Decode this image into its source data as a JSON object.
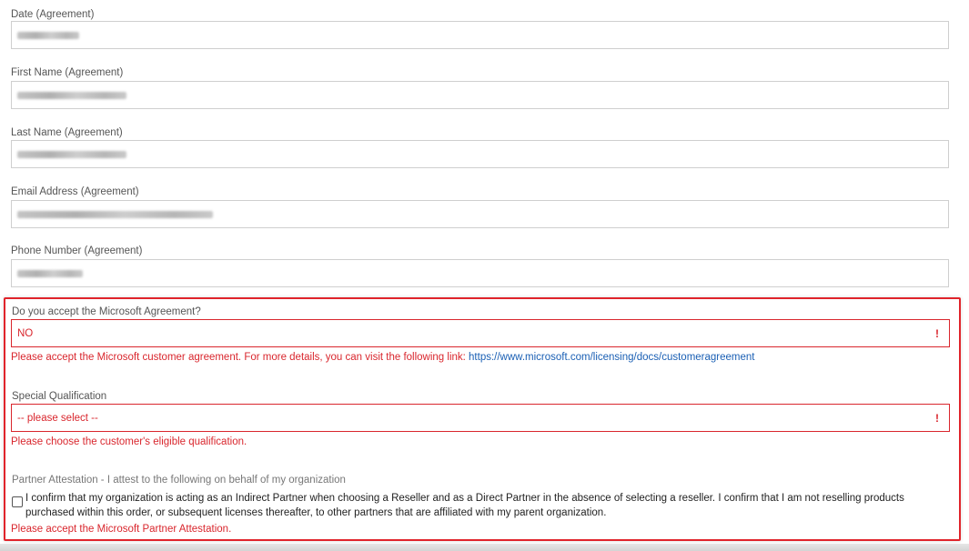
{
  "fields": [
    {
      "label": "Date (Agreement)"
    },
    {
      "label": "First Name (Agreement)"
    },
    {
      "label": "Last Name (Agreement)"
    },
    {
      "label": "Email Address (Agreement)"
    },
    {
      "label": "Phone Number (Agreement)"
    }
  ],
  "agreement": {
    "label": "Do you accept the Microsoft Agreement?",
    "value": "NO",
    "error_text": "Please accept the Microsoft customer agreement. For more details, you can visit the following link: ",
    "error_link": "https://www.microsoft.com/licensing/docs/customeragreement"
  },
  "qualification": {
    "label": "Special Qualification",
    "value": "-- please select --",
    "error_text": "Please choose the customer's eligible qualification."
  },
  "attestation": {
    "label": "Partner Attestation - I attest to the following on behalf of my organization",
    "checkbox_text": "I confirm that my organization is acting as an Indirect Partner when choosing a Reseller and as a Direct Partner in the absence of selecting a reseller. I confirm that I am not reselling products purchased within this order, or subsequent licenses thereafter, to other partners that are affiliated with my parent organization.",
    "error_text": "Please accept the Microsoft Partner Attestation."
  },
  "error_icon": "!",
  "colors": {
    "error": "#d9262d",
    "link": "#1a5fb4",
    "border": "#cfcfcf"
  }
}
